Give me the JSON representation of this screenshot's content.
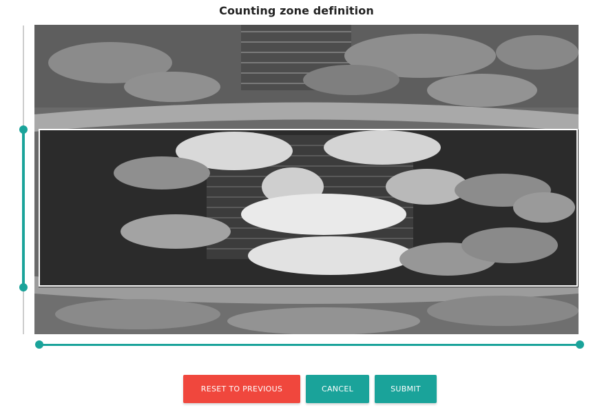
{
  "title": "Counting zone definition",
  "colors": {
    "accent": "#1aa39a",
    "reset": "#f0473d",
    "zone_border": "#ffffff",
    "track": "#cccccc"
  },
  "camera": {
    "image": "overhead pig pen camera view (grayscale)"
  },
  "sliders": {
    "vertical": {
      "icon": "vertical-range-slider",
      "range_percent": [
        33.6,
        84.6
      ]
    },
    "horizontal": {
      "icon": "horizontal-range-slider",
      "range_percent": [
        0.8,
        100
      ]
    }
  },
  "buttons": {
    "reset": "RESET TO PREVIOUS",
    "cancel": "CANCEL",
    "submit": "SUBMIT"
  }
}
